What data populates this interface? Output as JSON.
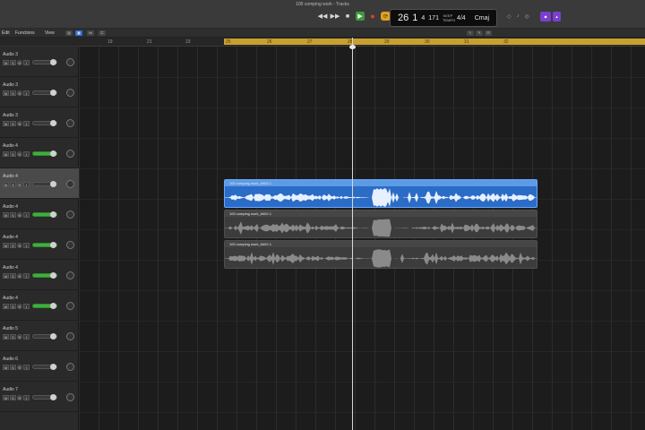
{
  "window": {
    "title": "100 comping work - Tracks"
  },
  "transport": {
    "rewind_icon": "rewind-icon",
    "forward_icon": "fast-forward-icon",
    "stop_icon": "stop-icon",
    "play_icon": "play-icon",
    "record_icon": "record-icon",
    "cycle_icon": "cycle-icon"
  },
  "lcd": {
    "bar": "26",
    "beat": "1",
    "division": "4",
    "ticks": "171",
    "tempo_label": "KEEP TEMPO",
    "time_signature": "4/4",
    "key": "Cmaj"
  },
  "toolbar": {
    "menu_edit": "Edit",
    "menu_functions": "Functions",
    "menu_view": "View"
  },
  "ruler": {
    "bars_before": [
      "19",
      "21",
      "23"
    ],
    "cycle_bars": [
      "25",
      "26",
      "27",
      "28",
      "29",
      "30",
      "31",
      "32"
    ]
  },
  "tracks": [
    {
      "name": "Audio 3",
      "mute": "M",
      "solo": "S",
      "rec": "R",
      "input": "I",
      "fader_active": false,
      "selected": false
    },
    {
      "name": "Audio 3",
      "mute": "M",
      "solo": "S",
      "rec": "R",
      "input": "I",
      "fader_active": false,
      "selected": false
    },
    {
      "name": "Audio 3",
      "mute": "M",
      "solo": "S",
      "rec": "R",
      "input": "I",
      "fader_active": false,
      "selected": false
    },
    {
      "name": "Audio 4",
      "mute": "M",
      "solo": "S",
      "rec": "R",
      "input": "I",
      "fader_active": true,
      "selected": false
    },
    {
      "name": "Audio 4",
      "mute": "M",
      "solo": "S",
      "rec": "R",
      "input": "I",
      "fader_active": false,
      "selected": true
    },
    {
      "name": "Audio 4",
      "mute": "M",
      "solo": "S",
      "rec": "R",
      "input": "I",
      "fader_active": true,
      "selected": false
    },
    {
      "name": "Audio 4",
      "mute": "M",
      "solo": "S",
      "rec": "R",
      "input": "I",
      "fader_active": true,
      "selected": false
    },
    {
      "name": "Audio 4",
      "mute": "M",
      "solo": "S",
      "rec": "R",
      "input": "I",
      "fader_active": true,
      "selected": false
    },
    {
      "name": "Audio 4",
      "mute": "M",
      "solo": "S",
      "rec": "R",
      "input": "I",
      "fader_active": true,
      "selected": false
    },
    {
      "name": "Audio 5",
      "mute": "M",
      "solo": "S",
      "rec": "R",
      "input": "I",
      "fader_active": false,
      "selected": false
    },
    {
      "name": "Audio 6",
      "mute": "M",
      "solo": "S",
      "rec": "R",
      "input": "I",
      "fader_active": false,
      "selected": false
    },
    {
      "name": "Audio 7",
      "mute": "M",
      "solo": "S",
      "rec": "R",
      "input": "I",
      "fader_active": false,
      "selected": false
    }
  ],
  "regions": [
    {
      "label": "100 comping work_6#02.1",
      "style": "blue"
    },
    {
      "label": "100 comping work_6#02.1",
      "style": "gray"
    },
    {
      "label": "100 comping work_6#02.1",
      "style": "gray"
    }
  ],
  "colors": {
    "accent_blue": "#2a6cc6",
    "cycle_yellow": "#c8a030",
    "fader_green": "#3fae3f",
    "play_green": "#3a9a3a",
    "record_red": "#e03a3a"
  }
}
